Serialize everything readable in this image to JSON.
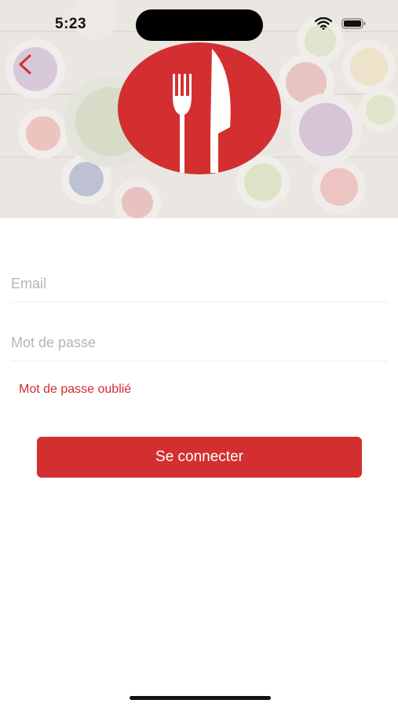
{
  "status_bar": {
    "time": "5:23"
  },
  "form": {
    "email_placeholder": "Email",
    "password_placeholder": "Mot de passe",
    "forgot_password": "Mot de passe oublié",
    "submit_label": "Se connecter"
  },
  "colors": {
    "accent": "#d32f31"
  },
  "icons": [
    "back-chevron-icon",
    "restaurant-logo-icon",
    "wifi-icon",
    "battery-icon",
    "cellular-icon"
  ]
}
